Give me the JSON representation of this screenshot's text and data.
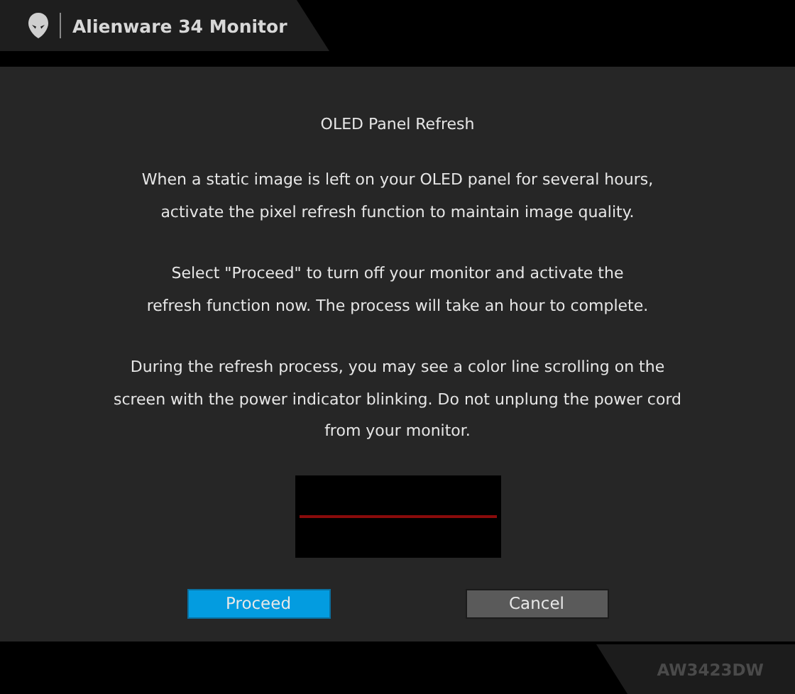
{
  "header": {
    "title": "Alienware 34 Monitor"
  },
  "dialog": {
    "title": "OLED Panel Refresh",
    "paragraphs": [
      {
        "lines": [
          "When a static image is left on your OLED panel for several hours,",
          "activate the pixel refresh function to maintain image quality."
        ]
      },
      {
        "lines": [
          "Select \"Proceed\" to turn off your monitor and activate the",
          "refresh function now. The process will take an hour to complete."
        ]
      },
      {
        "lines": [
          "During the refresh process, you may see a color line scrolling on the",
          "screen with the power indicator blinking. Do not unplung the power cord",
          "from your monitor."
        ]
      }
    ],
    "buttons": [
      {
        "label": "Proceed",
        "selected": true
      },
      {
        "label": "Cancel",
        "selected": false
      }
    ]
  },
  "footer": {
    "model": "AW3423DW"
  }
}
